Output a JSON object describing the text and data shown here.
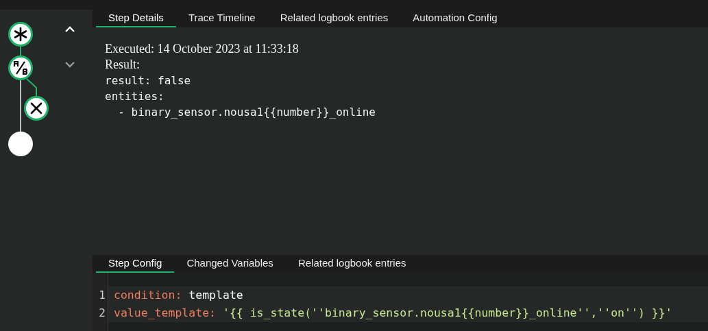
{
  "graph": {
    "nodes": [
      {
        "kind": "trigger"
      },
      {
        "kind": "condition"
      },
      {
        "kind": "stop"
      },
      {
        "kind": "end"
      }
    ]
  },
  "top_tabs": [
    {
      "label": "Step Details",
      "selected": true
    },
    {
      "label": "Trace Timeline",
      "selected": false
    },
    {
      "label": "Related logbook entries",
      "selected": false
    },
    {
      "label": "Automation Config",
      "selected": false
    }
  ],
  "details": {
    "executed": "Executed: 14 October 2023 at 11:33:18",
    "result_label": "Result:",
    "yaml_lines": [
      "result: false",
      "entities:",
      "  - binary_sensor.nousa1{{number}}_online"
    ]
  },
  "bottom_tabs": [
    {
      "label": "Step Config",
      "selected": true
    },
    {
      "label": "Changed Variables",
      "selected": false
    },
    {
      "label": "Related logbook entries",
      "selected": false
    }
  ],
  "editor": {
    "lines": [
      {
        "number": "1",
        "key": "condition:",
        "value": "template",
        "kind": "plain"
      },
      {
        "number": "2",
        "key": "value_template:",
        "value": "'{{ is_state(''binary_sensor.nousa1{{number}}_online'',''on'') }}'",
        "kind": "string"
      }
    ]
  }
}
